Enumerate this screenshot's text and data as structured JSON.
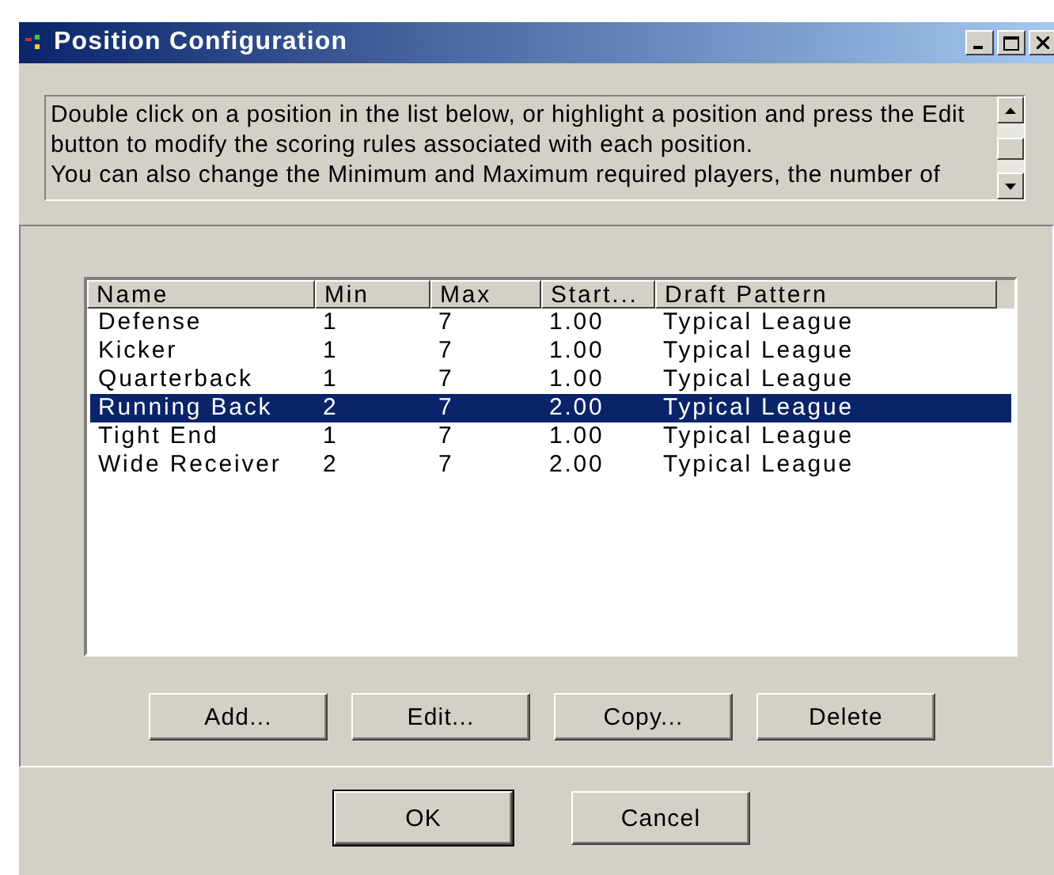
{
  "window": {
    "title": "Position Configuration"
  },
  "description": {
    "lines": [
      "Double click on a position in the list below, or highlight a position and press the Edit",
      "button to modify the scoring rules associated with each position.",
      "You can also change the Minimum and Maximum required players, the number of"
    ]
  },
  "table": {
    "columns": [
      "Name",
      "Min",
      "Max",
      "Start...",
      "Draft Pattern"
    ],
    "rows": [
      {
        "cells": [
          "Defense",
          "1",
          "7",
          "1.00",
          "Typical League"
        ],
        "selected": false
      },
      {
        "cells": [
          "Kicker",
          "1",
          "7",
          "1.00",
          "Typical League"
        ],
        "selected": false
      },
      {
        "cells": [
          "Quarterback",
          "1",
          "7",
          "1.00",
          "Typical League"
        ],
        "selected": false
      },
      {
        "cells": [
          "Running Back",
          "2",
          "7",
          "2.00",
          "Typical League"
        ],
        "selected": true
      },
      {
        "cells": [
          "Tight End",
          "1",
          "7",
          "1.00",
          "Typical League"
        ],
        "selected": false
      },
      {
        "cells": [
          "Wide Receiver",
          "2",
          "7",
          "2.00",
          "Typical League"
        ],
        "selected": false
      }
    ]
  },
  "list_buttons": [
    "Add...",
    "Edit...",
    "Copy...",
    "Delete"
  ],
  "dialog_buttons": [
    {
      "label": "OK",
      "default": true
    },
    {
      "label": "Cancel",
      "default": false
    }
  ]
}
